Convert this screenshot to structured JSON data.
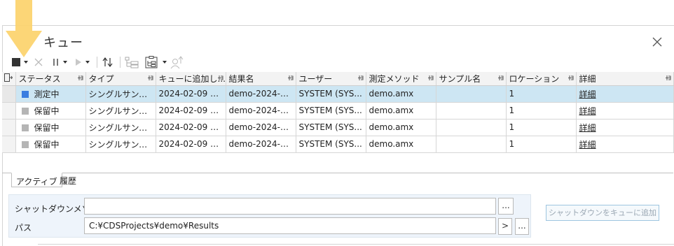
{
  "window": {
    "title": "キュー"
  },
  "toolbar": {
    "stop_icon": "stop-icon",
    "cancel_icon": "x-icon",
    "pause_icon": "pause-icon",
    "play_icon": "play-icon",
    "sort_icon": "sort-arrows-icon",
    "tree_icon": "tree-icon",
    "tree_dropdown_icon": "clipboard-tree-icon",
    "user_icon": "user-priority-icon"
  },
  "grid": {
    "columns": [
      "ステータス",
      "タイプ",
      "キューに追加し...",
      "結果名",
      "ユーザー",
      "測定メソッド",
      "サンプル名",
      "ロケーション",
      "詳細"
    ],
    "rows": [
      {
        "status": "測定中",
        "status_color": "#3a7de0",
        "type": "シングルサンプル",
        "added": "2024-02-09 1...",
        "result": "demo-2024-0...",
        "user": "SYSTEM (SYS...",
        "method": "demo.amx",
        "sample": "",
        "location": "1",
        "detail": "詳細",
        "selected": true
      },
      {
        "status": "保留中",
        "status_color": "#b5b5b5",
        "type": "シングルサンプル",
        "added": "2024-02-09 1...",
        "result": "demo-2024-0...",
        "user": "SYSTEM (SYS...",
        "method": "demo.amx",
        "sample": "",
        "location": "1",
        "detail": "詳細",
        "selected": false
      },
      {
        "status": "保留中",
        "status_color": "#b5b5b5",
        "type": "シングルサンプル",
        "added": "2024-02-09 1...",
        "result": "demo-2024-0...",
        "user": "SYSTEM (SYS...",
        "method": "demo.amx",
        "sample": "",
        "location": "1",
        "detail": "詳細",
        "selected": false
      },
      {
        "status": "保留中",
        "status_color": "#b5b5b5",
        "type": "シングルサンプル",
        "added": "2024-02-09 1...",
        "result": "demo-2024-0...",
        "user": "SYSTEM (SYS...",
        "method": "demo.amx",
        "sample": "",
        "location": "1",
        "detail": "詳細",
        "selected": false
      }
    ]
  },
  "tabs": {
    "active": "アクティブ",
    "history": "履歴"
  },
  "shutdown": {
    "method_label": "シャットダウンメソッド",
    "method_value": "",
    "browse_label": "...",
    "path_label": "パス",
    "path_value": "C:¥CDSProjects¥demo¥Results",
    "path_go_label": ">",
    "path_browse_label": "...",
    "add_button": "シャットダウンをキューに追加"
  },
  "colors": {
    "accent_arrow": "#fcd36b",
    "selected_row": "#cde6f3",
    "running": "#3a7de0",
    "pending": "#b5b5b5"
  }
}
